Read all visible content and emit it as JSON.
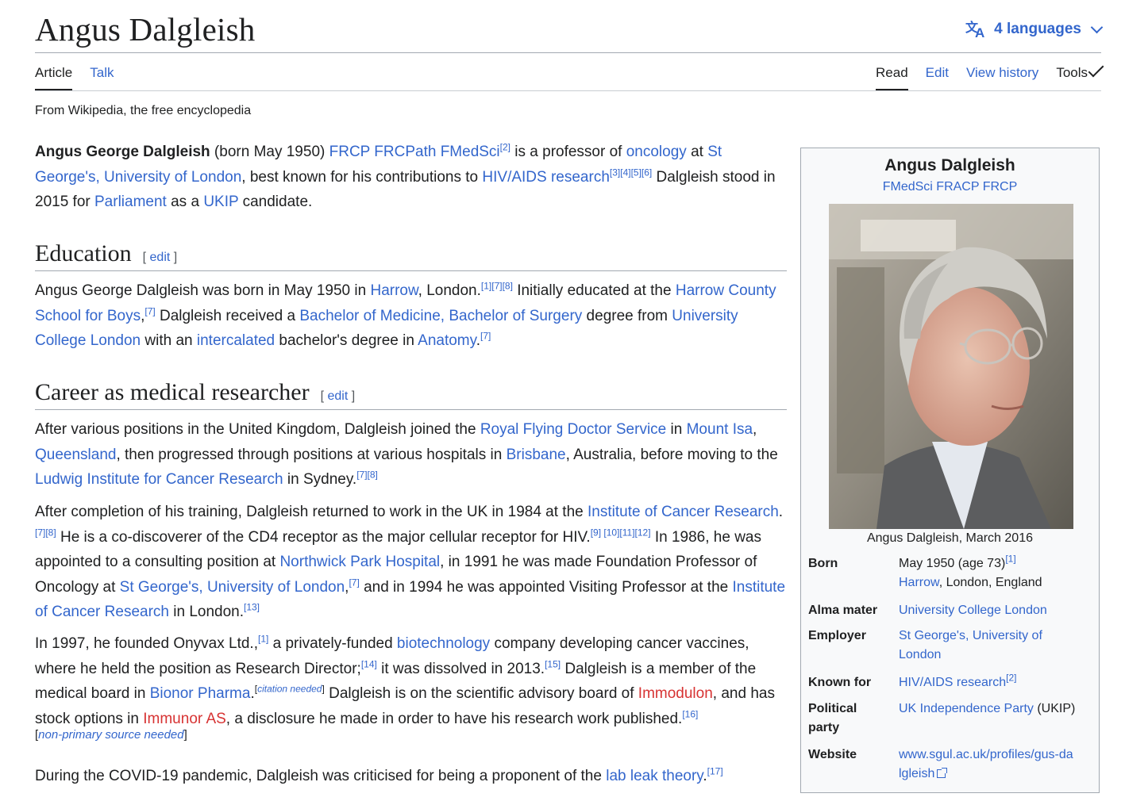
{
  "page": {
    "title": "Angus Dalgleish",
    "languages_label": "4 languages",
    "tagline": "From Wikipedia, the free encyclopedia"
  },
  "tabs_left": [
    "Article",
    "Talk"
  ],
  "tabs_right": [
    "Read",
    "Edit",
    "View history"
  ],
  "tools_label": "Tools",
  "edit_label": "edit",
  "sections": {
    "education": "Education",
    "career": "Career as medical researcher"
  },
  "intro": {
    "name_bold": "Angus George Dalgleish",
    "t1": " (born May 1950) ",
    "l_postnominals": "FRCP FRCPath FMedSci",
    "r2": "[2]",
    "t2": " is a professor of ",
    "l_oncology": "oncology",
    "t3": " at ",
    "l_stgeorges": "St George's, University of London",
    "t4": ", best known for his contributions to ",
    "l_hiv": "HIV/AIDS research",
    "r3456": "[3][4][5][6]",
    "t5": " Dalgleish stood in 2015 for ",
    "l_parliament": "Parliament",
    "t6": " as a ",
    "l_ukip": "UKIP",
    "t7": " candidate."
  },
  "education": {
    "t1": "Angus George Dalgleish was born in May 1950 in ",
    "l_harrow": "Harrow",
    "t2": ", London.",
    "r178": "[1][7][8]",
    "t3": " Initially educated at the ",
    "l_hcsb": "Harrow County School for Boys",
    "t4": ",",
    "r7a": "[7]",
    "t5": " Dalgleish received a ",
    "l_mbbs": "Bachelor of Medicine, Bachelor of Surgery",
    "t6": " degree from ",
    "l_ucl": "University College London",
    "t7": " with an ",
    "l_intercalated": "intercalated",
    "t8": " bachelor's degree in ",
    "l_anatomy": "Anatomy",
    "t9": ".",
    "r7b": "[7]"
  },
  "career_p1": {
    "t1": "After various positions in the United Kingdom, Dalgleish joined the ",
    "l_rfds": "Royal Flying Doctor Service",
    "t2": " in ",
    "l_mountisa": "Mount Isa",
    "t3": ", ",
    "l_queensland": "Queensland",
    "t4": ", then progressed through positions at various hospitals in ",
    "l_brisbane": "Brisbane",
    "t5": ", Australia, before moving to the ",
    "l_ludwig": "Ludwig Institute for Cancer Research",
    "t6": " in Sydney.",
    "r78": "[7][8]"
  },
  "career_p2": {
    "t1": "After completion of his training, Dalgleish returned to work in the UK in 1984 at the ",
    "l_icr": "Institute of Cancer Research",
    "t2": ".",
    "r78": "[7][8]",
    "t3": " He is a co-discoverer of the CD4 receptor as the major cellular receptor for HIV.",
    "r9": "[9]",
    "r101112": " [10][11][12]",
    "t4": " In 1986, he was appointed to a consulting position at ",
    "l_northwick": "Northwick Park Hospital",
    "t5": ", in 1991 he was made Foundation Professor of Oncology at ",
    "l_stgeorges": "St George's, University of London",
    "t6": ",",
    "r7": "[7]",
    "t7": " and in 1994 he was appointed Visiting Professor at the ",
    "l_icr2": "Institute of Cancer Research",
    "t8": " in London.",
    "r13": "[13]"
  },
  "career_p3": {
    "t1": "In 1997, he founded Onyvax Ltd.,",
    "r1": "[1]",
    "t2": " a privately-funded ",
    "l_biotech": "biotechnology",
    "t3": " company developing cancer vaccines, where he held the position as Research Director;",
    "r14": "[14]",
    "t4": " it was dissolved in 2013.",
    "r15": "[15]",
    "t5": " Dalgleish is a member of the medical board in ",
    "l_bionor": "Bionor Pharma",
    "t6": ".",
    "cn_open": "[",
    "cn_text": "citation needed",
    "cn_close": "]",
    "t7": " Dalgleish is on the scientific advisory board of ",
    "l_immodulon": "Immodulon",
    "t8": ", and has stock options in ",
    "l_immunor": "Immunor AS",
    "t9": ", a disclosure he made in order to have his research work published.",
    "r16": "[16]",
    "np_open": "[",
    "np_text": "non-primary source needed",
    "np_close": "]"
  },
  "career_p4": {
    "t1": "During the COVID-19 pandemic, Dalgleish was criticised for being a proponent of the ",
    "l_lableak": "lab leak theory",
    "t2": ".",
    "r17": "[17]"
  },
  "infobox": {
    "title": "Angus Dalgleish",
    "subtitle": "FMedSci FRACP FRCP",
    "caption": "Angus Dalgleish, March 2016",
    "born_label": "Born",
    "born_date": "May 1950 (age 73)",
    "born_ref": "[1]",
    "born_place_link": "Harrow",
    "born_place_rest": ", London, England",
    "alma_label": "Alma mater",
    "alma_value": "University College London",
    "employer_label": "Employer",
    "employer_value": "St George's, University of London",
    "known_label": "Known for",
    "known_value": "HIV/AIDS research",
    "known_ref": "[2]",
    "party_label": "Political party",
    "party_link": "UK Independence Party",
    "party_rest": " (UKIP)",
    "website_label": "Website",
    "website_value": "www.sgul.ac.uk/profiles/gus-dalgleish"
  },
  "icons": [
    "translate-icon",
    "chevron-down-icon",
    "external-link-icon"
  ],
  "colors": {
    "link": "#3366cc",
    "redlink": "#d73333",
    "text": "#202122",
    "infobox_bg": "#f8f9fa"
  }
}
